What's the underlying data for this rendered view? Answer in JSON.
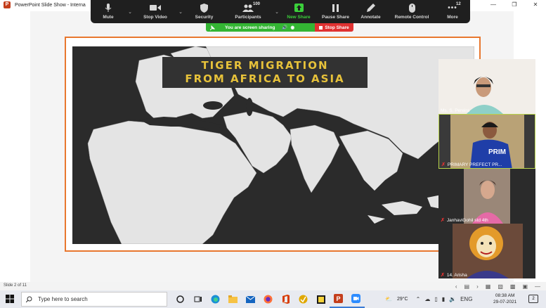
{
  "window": {
    "title": "PowerPoint Slide Show - Interna",
    "controls": [
      "minimize",
      "restore",
      "close"
    ]
  },
  "zoom_toolbar": {
    "items": [
      {
        "label": "Mute",
        "icon": "microphone-icon"
      },
      {
        "label": "Stop Video",
        "icon": "video-camera-icon"
      },
      {
        "label": "Security",
        "icon": "shield-icon"
      },
      {
        "label": "Participants",
        "icon": "participants-icon",
        "count": "100"
      },
      {
        "label": "New Share",
        "icon": "share-up-arrow-icon"
      },
      {
        "label": "Pause Share",
        "icon": "pause-icon"
      },
      {
        "label": "Annotate",
        "icon": "pencil-icon"
      },
      {
        "label": "Remote Control",
        "icon": "mouse-icon"
      },
      {
        "label": "More",
        "icon": "ellipsis-icon",
        "count": "12"
      }
    ]
  },
  "share_bar": {
    "status": "You are screen sharing",
    "stop_label": "Stop Share"
  },
  "slide": {
    "title_line1": "TIGER MIGRATION",
    "title_line2": "FROM AFRICA TO ASIA"
  },
  "participants": [
    {
      "name": "Ms. S. Pereira",
      "muted": false
    },
    {
      "name": "PRIMARY PREFECT PR...",
      "muted": true
    },
    {
      "name": "JanhaviGohil  std 4th",
      "muted": true
    },
    {
      "name": "14. Arisha",
      "muted": true
    }
  ],
  "statusbar": {
    "slide_number": "Slide 2 of 11"
  },
  "taskbar": {
    "search_placeholder": "Type here to search",
    "temperature": "29°C",
    "language": "ENG",
    "time": "08:38 AM",
    "date": "29-07-2021",
    "notification_count": "2"
  },
  "colors": {
    "zoom_bar": "#1f1f1f",
    "share_green": "#33b533",
    "stop_red": "#e03131",
    "slide_border": "#e8772e",
    "title_text": "#e7c23a"
  }
}
